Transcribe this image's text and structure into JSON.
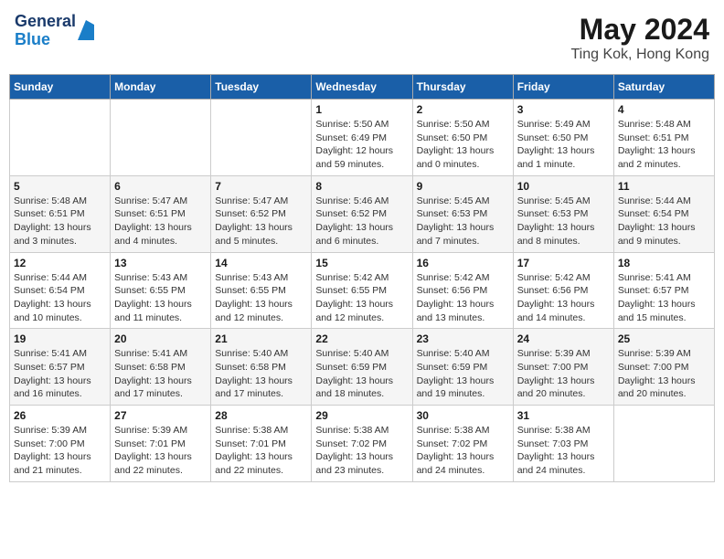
{
  "header": {
    "logo_general": "General",
    "logo_blue": "Blue",
    "month_year": "May 2024",
    "location": "Ting Kok, Hong Kong"
  },
  "weekdays": [
    "Sunday",
    "Monday",
    "Tuesday",
    "Wednesday",
    "Thursday",
    "Friday",
    "Saturday"
  ],
  "weeks": [
    [
      {
        "day": "",
        "info": ""
      },
      {
        "day": "",
        "info": ""
      },
      {
        "day": "",
        "info": ""
      },
      {
        "day": "1",
        "info": "Sunrise: 5:50 AM\nSunset: 6:49 PM\nDaylight: 12 hours\nand 59 minutes."
      },
      {
        "day": "2",
        "info": "Sunrise: 5:50 AM\nSunset: 6:50 PM\nDaylight: 13 hours\nand 0 minutes."
      },
      {
        "day": "3",
        "info": "Sunrise: 5:49 AM\nSunset: 6:50 PM\nDaylight: 13 hours\nand 1 minute."
      },
      {
        "day": "4",
        "info": "Sunrise: 5:48 AM\nSunset: 6:51 PM\nDaylight: 13 hours\nand 2 minutes."
      }
    ],
    [
      {
        "day": "5",
        "info": "Sunrise: 5:48 AM\nSunset: 6:51 PM\nDaylight: 13 hours\nand 3 minutes."
      },
      {
        "day": "6",
        "info": "Sunrise: 5:47 AM\nSunset: 6:51 PM\nDaylight: 13 hours\nand 4 minutes."
      },
      {
        "day": "7",
        "info": "Sunrise: 5:47 AM\nSunset: 6:52 PM\nDaylight: 13 hours\nand 5 minutes."
      },
      {
        "day": "8",
        "info": "Sunrise: 5:46 AM\nSunset: 6:52 PM\nDaylight: 13 hours\nand 6 minutes."
      },
      {
        "day": "9",
        "info": "Sunrise: 5:45 AM\nSunset: 6:53 PM\nDaylight: 13 hours\nand 7 minutes."
      },
      {
        "day": "10",
        "info": "Sunrise: 5:45 AM\nSunset: 6:53 PM\nDaylight: 13 hours\nand 8 minutes."
      },
      {
        "day": "11",
        "info": "Sunrise: 5:44 AM\nSunset: 6:54 PM\nDaylight: 13 hours\nand 9 minutes."
      }
    ],
    [
      {
        "day": "12",
        "info": "Sunrise: 5:44 AM\nSunset: 6:54 PM\nDaylight: 13 hours\nand 10 minutes."
      },
      {
        "day": "13",
        "info": "Sunrise: 5:43 AM\nSunset: 6:55 PM\nDaylight: 13 hours\nand 11 minutes."
      },
      {
        "day": "14",
        "info": "Sunrise: 5:43 AM\nSunset: 6:55 PM\nDaylight: 13 hours\nand 12 minutes."
      },
      {
        "day": "15",
        "info": "Sunrise: 5:42 AM\nSunset: 6:55 PM\nDaylight: 13 hours\nand 12 minutes."
      },
      {
        "day": "16",
        "info": "Sunrise: 5:42 AM\nSunset: 6:56 PM\nDaylight: 13 hours\nand 13 minutes."
      },
      {
        "day": "17",
        "info": "Sunrise: 5:42 AM\nSunset: 6:56 PM\nDaylight: 13 hours\nand 14 minutes."
      },
      {
        "day": "18",
        "info": "Sunrise: 5:41 AM\nSunset: 6:57 PM\nDaylight: 13 hours\nand 15 minutes."
      }
    ],
    [
      {
        "day": "19",
        "info": "Sunrise: 5:41 AM\nSunset: 6:57 PM\nDaylight: 13 hours\nand 16 minutes."
      },
      {
        "day": "20",
        "info": "Sunrise: 5:41 AM\nSunset: 6:58 PM\nDaylight: 13 hours\nand 17 minutes."
      },
      {
        "day": "21",
        "info": "Sunrise: 5:40 AM\nSunset: 6:58 PM\nDaylight: 13 hours\nand 17 minutes."
      },
      {
        "day": "22",
        "info": "Sunrise: 5:40 AM\nSunset: 6:59 PM\nDaylight: 13 hours\nand 18 minutes."
      },
      {
        "day": "23",
        "info": "Sunrise: 5:40 AM\nSunset: 6:59 PM\nDaylight: 13 hours\nand 19 minutes."
      },
      {
        "day": "24",
        "info": "Sunrise: 5:39 AM\nSunset: 7:00 PM\nDaylight: 13 hours\nand 20 minutes."
      },
      {
        "day": "25",
        "info": "Sunrise: 5:39 AM\nSunset: 7:00 PM\nDaylight: 13 hours\nand 20 minutes."
      }
    ],
    [
      {
        "day": "26",
        "info": "Sunrise: 5:39 AM\nSunset: 7:00 PM\nDaylight: 13 hours\nand 21 minutes."
      },
      {
        "day": "27",
        "info": "Sunrise: 5:39 AM\nSunset: 7:01 PM\nDaylight: 13 hours\nand 22 minutes."
      },
      {
        "day": "28",
        "info": "Sunrise: 5:38 AM\nSunset: 7:01 PM\nDaylight: 13 hours\nand 22 minutes."
      },
      {
        "day": "29",
        "info": "Sunrise: 5:38 AM\nSunset: 7:02 PM\nDaylight: 13 hours\nand 23 minutes."
      },
      {
        "day": "30",
        "info": "Sunrise: 5:38 AM\nSunset: 7:02 PM\nDaylight: 13 hours\nand 24 minutes."
      },
      {
        "day": "31",
        "info": "Sunrise: 5:38 AM\nSunset: 7:03 PM\nDaylight: 13 hours\nand 24 minutes."
      },
      {
        "day": "",
        "info": ""
      }
    ]
  ]
}
